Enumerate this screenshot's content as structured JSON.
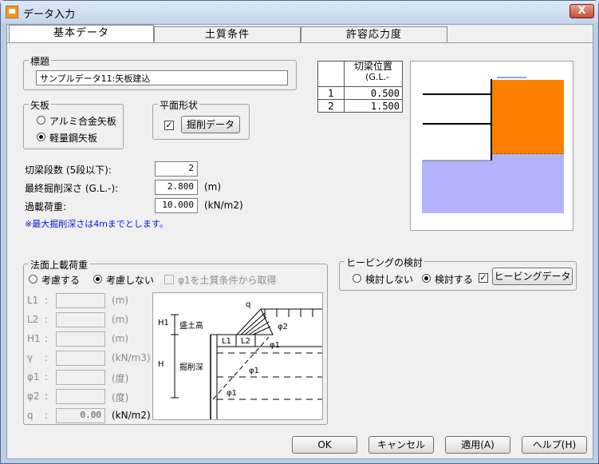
{
  "window": {
    "title": "データ入力",
    "close_glyph": "X"
  },
  "tabs": [
    "基本データ",
    "土質条件",
    "許容応力度"
  ],
  "title_group": {
    "label": "標題",
    "value": "サンプルデータ11:矢板建込"
  },
  "yaita": {
    "label": "矢板",
    "options": [
      "アルミ合金矢板",
      "軽量鋼矢板"
    ],
    "selected": 1
  },
  "shape": {
    "label": "平面形状",
    "check": "✓",
    "button": "掘削データ"
  },
  "strut_table": {
    "header": "切梁位置",
    "header_sub": "(G.L.-",
    "rows": [
      {
        "no": "1",
        "value": "0.500"
      },
      {
        "no": "2",
        "value": "1.500"
      }
    ]
  },
  "fields": {
    "steps": {
      "label": "切梁段数 (5段以下):",
      "value": "2",
      "unit": ""
    },
    "depth": {
      "label": "最終掘削深さ (G.L.-):",
      "value": "2.800",
      "unit": "(m)"
    },
    "load": {
      "label": "過載荷重:",
      "value": "10.000",
      "unit": "(kN/m2)"
    }
  },
  "note": "※最大掘削深さは4mまでとします。",
  "slope": {
    "label": "法面上載荷重",
    "radio": [
      "考慮する",
      "考慮しない"
    ],
    "selected": 1,
    "checkbox": "φ1を土質条件から取得",
    "rows": [
      {
        "label": "L1",
        "value": "",
        "unit": "(m)"
      },
      {
        "label": "L2",
        "value": "",
        "unit": "(m)"
      },
      {
        "label": "H1",
        "value": "",
        "unit": "(m)"
      },
      {
        "label": "γ",
        "value": "",
        "unit": "(kN/m3)"
      },
      {
        "label": "φ1",
        "value": "",
        "unit": "(度)"
      },
      {
        "label": "φ2",
        "value": "",
        "unit": "(度)"
      },
      {
        "label": "q",
        "value": "0.00",
        "unit": "(kN/m2)"
      }
    ],
    "colon": ":",
    "diagram": {
      "q": "q",
      "h1": "H1",
      "h": "H",
      "mori": "盛土高",
      "kussaku": "掘削深",
      "l1": "L1",
      "l2": "L2",
      "phi1": "φ1",
      "phi2": "φ2"
    }
  },
  "heaving": {
    "label": "ヒービングの検討",
    "radio": [
      "検討しない",
      "検討する"
    ],
    "selected": 1,
    "check": "✓",
    "button": "ヒービングデータ"
  },
  "buttons": {
    "ok": "OK",
    "cancel": "キャンセル",
    "apply": "適用(A)",
    "help": "ヘルプ(H)"
  },
  "colors": {
    "orange_soil": "#ff8000",
    "purple_soil": "#b3b3ff",
    "note_text": "#0018e8"
  }
}
